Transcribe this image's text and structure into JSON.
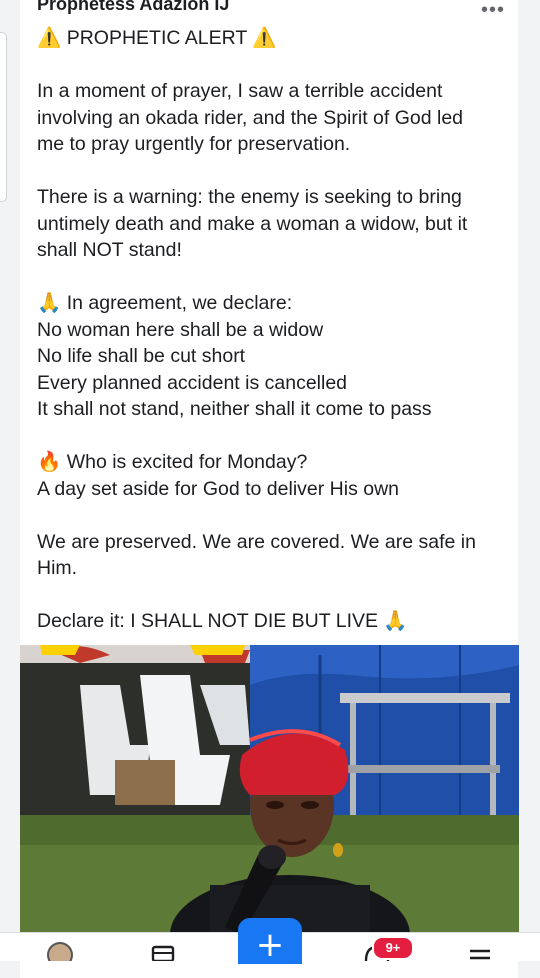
{
  "post": {
    "author": "Prophetess Adazion IJ",
    "more_icon": "more-horizontal-icon",
    "lines": [
      {
        "emoji_before": "⚠️",
        "text": " PROPHETIC ALERT ",
        "emoji_after": "⚠️",
        "emoji_class": "warn"
      },
      {
        "text": ""
      },
      {
        "text": "In a moment of prayer, I saw a terrible accident"
      },
      {
        "text": "involving an okada rider,  and the Spirit of God led"
      },
      {
        "text": "me to pray urgently for preservation."
      },
      {
        "text": ""
      },
      {
        "text": "There is a warning: the enemy is seeking to bring"
      },
      {
        "text": "untimely death and make a woman a widow, but it"
      },
      {
        "text": "shall NOT stand!"
      },
      {
        "text": ""
      },
      {
        "emoji_before": "🙏",
        "text": " In agreement, we declare:",
        "emoji_class": "pray"
      },
      {
        "text": "No woman here shall be a widow"
      },
      {
        "text": "No life shall be cut short"
      },
      {
        "text": "Every planned accident is cancelled"
      },
      {
        "text": "It shall not stand, neither shall it come to pass"
      },
      {
        "text": ""
      },
      {
        "emoji_before": "🔥",
        "text": " Who is excited for Monday?",
        "emoji_class": "fire"
      },
      {
        "text": "A day set aside for God to deliver His own"
      },
      {
        "text": ""
      },
      {
        "text": "We are preserved. We are covered. We are safe in"
      },
      {
        "text": "Him."
      },
      {
        "text": ""
      },
      {
        "text": "Declare it: I SHALL NOT DIE BUT LIVE ",
        "emoji_after": "🙏",
        "emoji_class": "pray"
      }
    ]
  },
  "photo": {
    "description_icon": "photo-woman-praying-icon"
  },
  "bottom_nav": {
    "items": [
      {
        "name": "profile-avatar-icon"
      },
      {
        "name": "marketplace-icon"
      },
      {
        "name": "create-post-icon",
        "label": "+"
      },
      {
        "name": "notifications-icon",
        "badge": "9+"
      },
      {
        "name": "menu-icon"
      }
    ]
  },
  "colors": {
    "brand_blue": "#1877f2",
    "badge_red": "#e41e3f",
    "text": "#1c1e21"
  }
}
